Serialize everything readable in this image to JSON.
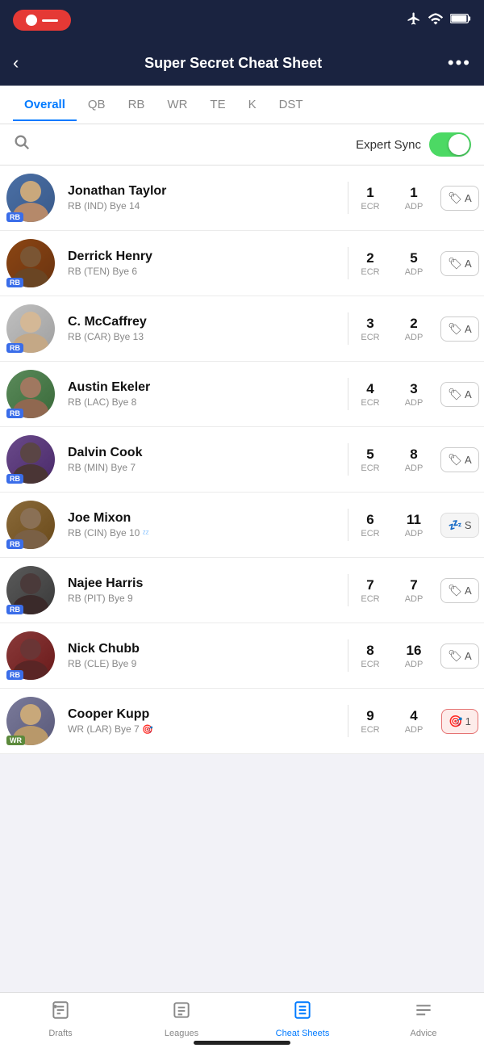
{
  "statusBar": {
    "recordLabel": "",
    "icons": {
      "airplane": "✈",
      "wifi": "WiFi",
      "battery": "Battery"
    }
  },
  "header": {
    "back": "‹",
    "title": "Super Secret Cheat Sheet",
    "more": "•••"
  },
  "tabs": [
    {
      "id": "overall",
      "label": "Overall",
      "active": true
    },
    {
      "id": "qb",
      "label": "QB",
      "active": false
    },
    {
      "id": "rb",
      "label": "RB",
      "active": false
    },
    {
      "id": "wr",
      "label": "WR",
      "active": false
    },
    {
      "id": "te",
      "label": "TE",
      "active": false
    },
    {
      "id": "k",
      "label": "K",
      "active": false
    },
    {
      "id": "dst",
      "label": "DST",
      "active": false
    }
  ],
  "search": {
    "placeholder": "Search"
  },
  "expertSync": {
    "label": "Expert Sync",
    "enabled": true
  },
  "players": [
    {
      "name": "Jonathan Taylor",
      "meta": "RB (IND) Bye 14",
      "pos": "RB",
      "posType": "rb",
      "ecr": "1",
      "adp": "1",
      "action": "tag",
      "actionLabel": "A",
      "sleepIcon": false,
      "targetIcon": false,
      "avatarClass": "av-jt",
      "emoji": "🏈"
    },
    {
      "name": "Derrick Henry",
      "meta": "RB (TEN) Bye 6",
      "pos": "RB",
      "posType": "rb",
      "ecr": "2",
      "adp": "5",
      "action": "tag",
      "actionLabel": "A",
      "sleepIcon": false,
      "targetIcon": false,
      "avatarClass": "av-dh",
      "emoji": "🏈"
    },
    {
      "name": "C. McCaffrey",
      "meta": "RB (CAR) Bye 13",
      "pos": "RB",
      "posType": "rb",
      "ecr": "3",
      "adp": "2",
      "action": "tag",
      "actionLabel": "A",
      "sleepIcon": false,
      "targetIcon": false,
      "avatarClass": "av-cm",
      "emoji": "🏈"
    },
    {
      "name": "Austin Ekeler",
      "meta": "RB (LAC) Bye 8",
      "pos": "RB",
      "posType": "rb",
      "ecr": "4",
      "adp": "3",
      "action": "tag",
      "actionLabel": "A",
      "sleepIcon": false,
      "targetIcon": false,
      "avatarClass": "av-ae",
      "emoji": "🏈"
    },
    {
      "name": "Dalvin Cook",
      "meta": "RB (MIN) Bye 7",
      "pos": "RB",
      "posType": "rb",
      "ecr": "5",
      "adp": "8",
      "action": "tag",
      "actionLabel": "A",
      "sleepIcon": false,
      "targetIcon": false,
      "avatarClass": "av-dc",
      "emoji": "🏈"
    },
    {
      "name": "Joe Mixon",
      "meta": "RB (CIN) Bye 10",
      "pos": "RB",
      "posType": "rb",
      "ecr": "6",
      "adp": "11",
      "action": "sleep",
      "actionLabel": "S",
      "sleepIcon": true,
      "targetIcon": false,
      "avatarClass": "av-jm",
      "emoji": "🏈"
    },
    {
      "name": "Najee Harris",
      "meta": "RB (PIT) Bye 9",
      "pos": "RB",
      "posType": "rb",
      "ecr": "7",
      "adp": "7",
      "action": "tag",
      "actionLabel": "A",
      "sleepIcon": false,
      "targetIcon": false,
      "avatarClass": "av-nh",
      "emoji": "🏈"
    },
    {
      "name": "Nick Chubb",
      "meta": "RB (CLE) Bye 9",
      "pos": "RB",
      "posType": "rb",
      "ecr": "8",
      "adp": "16",
      "action": "tag",
      "actionLabel": "A",
      "sleepIcon": false,
      "targetIcon": false,
      "avatarClass": "av-nc",
      "emoji": "🏈"
    },
    {
      "name": "Cooper Kupp",
      "meta": "WR (LAR) Bye 7",
      "pos": "WR",
      "posType": "wr",
      "ecr": "9",
      "adp": "4",
      "action": "target",
      "actionLabel": "1",
      "sleepIcon": false,
      "targetIcon": true,
      "avatarClass": "av-ck",
      "emoji": "🏈"
    }
  ],
  "bottomNav": [
    {
      "id": "drafts",
      "label": "Drafts",
      "icon": "drafts",
      "active": false
    },
    {
      "id": "leagues",
      "label": "Leagues",
      "icon": "leagues",
      "active": false
    },
    {
      "id": "cheatsheets",
      "label": "Cheat Sheets",
      "icon": "cheatsheets",
      "active": true
    },
    {
      "id": "advice",
      "label": "Advice",
      "icon": "advice",
      "active": false
    }
  ]
}
